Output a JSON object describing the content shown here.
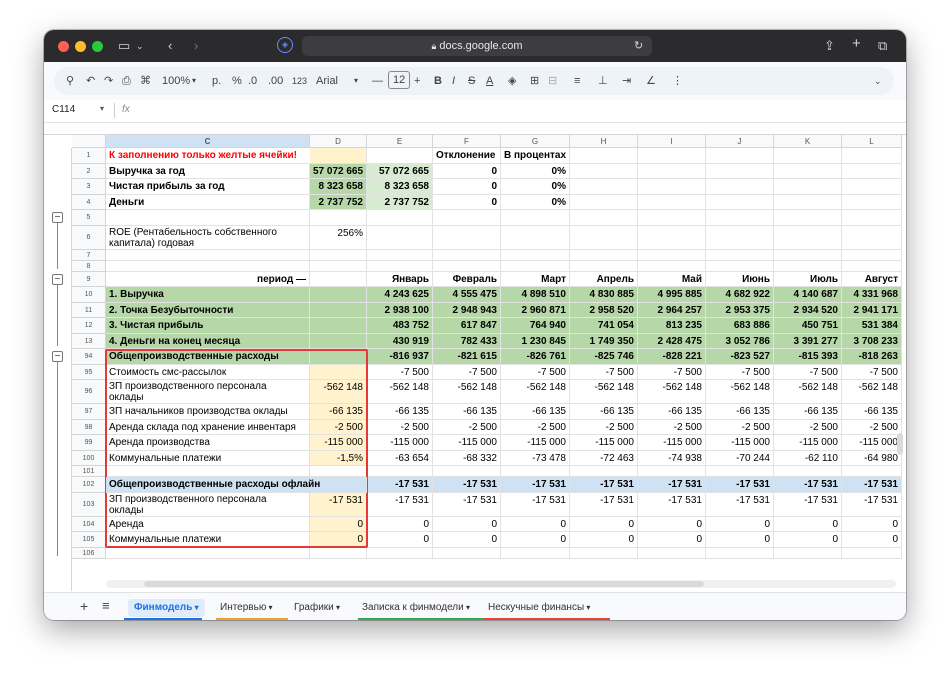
{
  "browser": {
    "url": "docs.google.com"
  },
  "toolbar": {
    "zoom": "100%",
    "currency_p": "р.",
    "percent": "%",
    "dec_less": ".0",
    "dec_more": ".00",
    "format_123": "123",
    "font": "Arial",
    "font_size": "12",
    "minus": "—",
    "plus": "+",
    "bold": "B",
    "italic": "I",
    "strike": "S",
    "text_color": "A"
  },
  "formula_bar": {
    "cell_ref": "C114",
    "fx": "fx"
  },
  "columns": [
    "C",
    "D",
    "E",
    "F",
    "G",
    "H",
    "I",
    "J",
    "K",
    "L"
  ],
  "row_numbers": [
    "1",
    "2",
    "3",
    "4",
    "5",
    "6",
    "7",
    "8",
    "9",
    "10",
    "11",
    "12",
    "13",
    "94",
    "95",
    "96",
    "97",
    "98",
    "99",
    "100",
    "101",
    "102",
    "103",
    "104",
    "105",
    "106"
  ],
  "rows": [
    {
      "c": "К заполнению только желтые ячейки!",
      "d": "",
      "e": "",
      "f": "Отклонение",
      "g": "В процентах",
      "h": "",
      "i": "",
      "j": "",
      "k": "",
      "l": ""
    },
    {
      "c": "Выручка за год",
      "d": "57 072 665",
      "e": "57 072 665",
      "f": "0",
      "g": "0%",
      "h": "",
      "i": "",
      "j": "",
      "k": "",
      "l": ""
    },
    {
      "c": "Чистая прибыль за год",
      "d": "8 323 658",
      "e": "8 323 658",
      "f": "0",
      "g": "0%",
      "h": "",
      "i": "",
      "j": "",
      "k": "",
      "l": ""
    },
    {
      "c": "Деньги",
      "d": "2 737 752",
      "e": "2 737 752",
      "f": "0",
      "g": "0%",
      "h": "",
      "i": "",
      "j": "",
      "k": "",
      "l": ""
    },
    {
      "c": "",
      "d": "",
      "e": "",
      "f": "",
      "g": "",
      "h": "",
      "i": "",
      "j": "",
      "k": "",
      "l": ""
    },
    {
      "c": "ROE (Рентабельность собственного",
      "c2": "капитала) годовая",
      "d": "256%",
      "e": "",
      "f": "",
      "g": "",
      "h": "",
      "i": "",
      "j": "",
      "k": "",
      "l": ""
    },
    {
      "c": "",
      "d": "",
      "e": "",
      "f": "",
      "g": "",
      "h": "",
      "i": "",
      "j": "",
      "k": "",
      "l": ""
    },
    {
      "c": "",
      "d": "",
      "e": "",
      "f": "",
      "g": "",
      "h": "",
      "i": "",
      "j": "",
      "k": "",
      "l": ""
    },
    {
      "c": "период —",
      "d": "",
      "e": "Январь",
      "f": "Февраль",
      "g": "Март",
      "h": "Апрель",
      "i": "Май",
      "j": "Июнь",
      "k": "Июль",
      "l": "Август"
    },
    {
      "c": "1. Выручка",
      "d": "",
      "e": "4 243 625",
      "f": "4 555 475",
      "g": "4 898 510",
      "h": "4 830 885",
      "i": "4 995 885",
      "j": "4 682 922",
      "k": "4 140 687",
      "l": "4 331 968"
    },
    {
      "c": "2. Точка Безубыточности",
      "d": "",
      "e": "2 938 100",
      "f": "2 948 943",
      "g": "2 960 871",
      "h": "2 958 520",
      "i": "2 964 257",
      "j": "2 953 375",
      "k": "2 934 520",
      "l": "2 941 171"
    },
    {
      "c": "3. Чистая прибыль",
      "d": "",
      "e": "483 752",
      "f": "617 847",
      "g": "764 940",
      "h": "741 054",
      "i": "813 235",
      "j": "683 886",
      "k": "450 751",
      "l": "531 384"
    },
    {
      "c": "4. Деньги на конец месяца",
      "d": "",
      "e": "430 919",
      "f": "782 433",
      "g": "1 230 845",
      "h": "1 749 350",
      "i": "2 428 475",
      "j": "3 052 786",
      "k": "3 391 277",
      "l": "3 708 233"
    },
    {
      "c": "Общепроизводственные расходы",
      "d": "",
      "e": "-816 937",
      "f": "-821 615",
      "g": "-826 761",
      "h": "-825 746",
      "i": "-828 221",
      "j": "-823 527",
      "k": "-815 393",
      "l": "-818 263"
    },
    {
      "c": "Стоимость смс-рассылок",
      "d": "",
      "e": "-7 500",
      "f": "-7 500",
      "g": "-7 500",
      "h": "-7 500",
      "i": "-7 500",
      "j": "-7 500",
      "k": "-7 500",
      "l": "-7 500"
    },
    {
      "c": "ЗП производственного персонала",
      "c2": "оклады",
      "d": "-562 148",
      "e": "-562 148",
      "f": "-562 148",
      "g": "-562 148",
      "h": "-562 148",
      "i": "-562 148",
      "j": "-562 148",
      "k": "-562 148",
      "l": "-562 148"
    },
    {
      "c": "ЗП начальников производства оклады",
      "d": "-66 135",
      "e": "-66 135",
      "f": "-66 135",
      "g": "-66 135",
      "h": "-66 135",
      "i": "-66 135",
      "j": "-66 135",
      "k": "-66 135",
      "l": "-66 135"
    },
    {
      "c": "Аренда склада под хранение инвентаря",
      "d": "-2 500",
      "e": "-2 500",
      "f": "-2 500",
      "g": "-2 500",
      "h": "-2 500",
      "i": "-2 500",
      "j": "-2 500",
      "k": "-2 500",
      "l": "-2 500"
    },
    {
      "c": "Аренда производства",
      "d": "-115 000",
      "e": "-115 000",
      "f": "-115 000",
      "g": "-115 000",
      "h": "-115 000",
      "i": "-115 000",
      "j": "-115 000",
      "k": "-115 000",
      "l": "-115 000"
    },
    {
      "c": "Коммунальные платежи",
      "d": "-1,5%",
      "e": "-63 654",
      "f": "-68 332",
      "g": "-73 478",
      "h": "-72 463",
      "i": "-74 938",
      "j": "-70 244",
      "k": "-62 110",
      "l": "-64 980"
    },
    {
      "c": "",
      "d": "",
      "e": "",
      "f": "",
      "g": "",
      "h": "",
      "i": "",
      "j": "",
      "k": "",
      "l": ""
    },
    {
      "c": "Общепроизводственные расходы офлайн",
      "d": "",
      "e": "-17 531",
      "f": "-17 531",
      "g": "-17 531",
      "h": "-17 531",
      "i": "-17 531",
      "j": "-17 531",
      "k": "-17 531",
      "l": "-17 531"
    },
    {
      "c": "ЗП производственного персонала",
      "c2": "оклады",
      "d": "-17 531",
      "e": "-17 531",
      "f": "-17 531",
      "g": "-17 531",
      "h": "-17 531",
      "i": "-17 531",
      "j": "-17 531",
      "k": "-17 531",
      "l": "-17 531"
    },
    {
      "c": "Аренда",
      "d": "0",
      "e": "0",
      "f": "0",
      "g": "0",
      "h": "0",
      "i": "0",
      "j": "0",
      "k": "0",
      "l": "0"
    },
    {
      "c": "Коммунальные платежи",
      "d": "0",
      "e": "0",
      "f": "0",
      "g": "0",
      "h": "0",
      "i": "0",
      "j": "0",
      "k": "0",
      "l": "0"
    },
    {
      "c": "",
      "d": "",
      "e": "",
      "f": "",
      "g": "",
      "h": "",
      "i": "",
      "j": "",
      "k": "",
      "l": ""
    }
  ],
  "sheet_tabs": [
    {
      "label": "Финмодель",
      "active": true,
      "color": "#1a73e8"
    },
    {
      "label": "Интервью",
      "active": false,
      "color": "#f0a030"
    },
    {
      "label": "Графики",
      "active": false,
      "color": ""
    },
    {
      "label": "Записка к финмодели",
      "active": false,
      "color": "#34a853"
    },
    {
      "label": "Нескучные финансы",
      "active": false,
      "color": "#ea4335"
    }
  ],
  "colors": {
    "green_fill": "#b6d7a8",
    "light_green_fill": "#d9ead3",
    "yellow_fill": "#fff2cc",
    "header_blue": "#cfe2f3",
    "red_text": "#ff0000",
    "highlight_box": "#e53935"
  }
}
